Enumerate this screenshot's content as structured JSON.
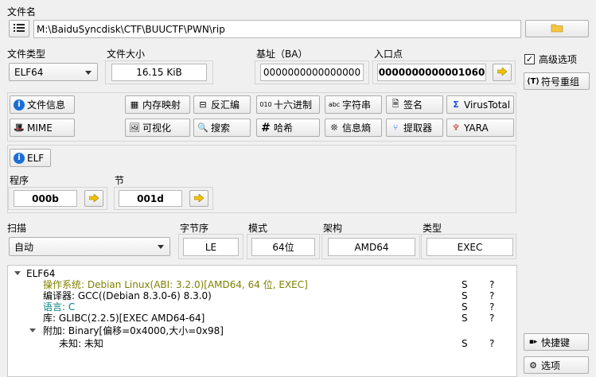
{
  "file": {
    "label": "文件名",
    "path": "M:\\BaiduSyncdisk\\CTF\\BUUCTF\\PWN\\rip"
  },
  "type": {
    "label": "文件类型",
    "value": "ELF64"
  },
  "size": {
    "label": "文件大小",
    "value": "16.15 KiB"
  },
  "base": {
    "label": "基址（BA）",
    "value": "0000000000000000"
  },
  "entry": {
    "label": "入口点",
    "value": "0000000000001060"
  },
  "advanced": {
    "label": "高级选项",
    "checked": true
  },
  "symbol_btn": "符号重组",
  "tools": {
    "file_info": "文件信息",
    "memory_map": "内存映射",
    "disasm": "反汇编",
    "hex": "十六进制",
    "strings": "字符串",
    "signature": "签名",
    "virustotal": "VirusTotal",
    "mime": "MIME",
    "visualize": "可视化",
    "search": "搜索",
    "hash": "哈希",
    "entropy": "信息熵",
    "extractor": "提取器",
    "yara": "YARA"
  },
  "elf_btn": "ELF",
  "program": {
    "label": "程序",
    "value": "000b"
  },
  "section": {
    "label": "节",
    "value": "001d"
  },
  "scan": {
    "label": "扫描",
    "value": "自动"
  },
  "endian": {
    "label": "字节序",
    "value": "LE"
  },
  "mode": {
    "label": "模式",
    "value": "64位"
  },
  "arch": {
    "label": "架构",
    "value": "AMD64"
  },
  "kind": {
    "label": "类型",
    "value": "EXEC"
  },
  "results": {
    "root": "ELF64",
    "rows": [
      {
        "text": "操作系统: Debian Linux(ABI: 3.2.0)[AMD64, 64 位, EXEC]",
        "s": "S",
        "q": "?",
        "color": "#808000"
      },
      {
        "text": "编译器: GCC((Debian 8.3.0-6) 8.3.0)",
        "s": "S",
        "q": "?",
        "color": "#000000"
      },
      {
        "text": "语言: C",
        "s": "S",
        "q": "?",
        "color": "#008080"
      },
      {
        "text": "库: GLIBC(2.2.5)[EXEC AMD64-64]",
        "s": "S",
        "q": "?",
        "color": "#000000"
      },
      {
        "text": "附加: Binary[偏移=0x4000,大小=0x98]",
        "s": "",
        "q": "",
        "color": "#000000"
      },
      {
        "text": "未知: 未知",
        "s": "S",
        "q": "?",
        "color": "#000000"
      }
    ]
  },
  "shortcut_btn": "快捷键",
  "options_btn": "选项",
  "colors": {
    "accent_blue": "#1a6fd6",
    "arrow_yellow": "#f2c200"
  }
}
